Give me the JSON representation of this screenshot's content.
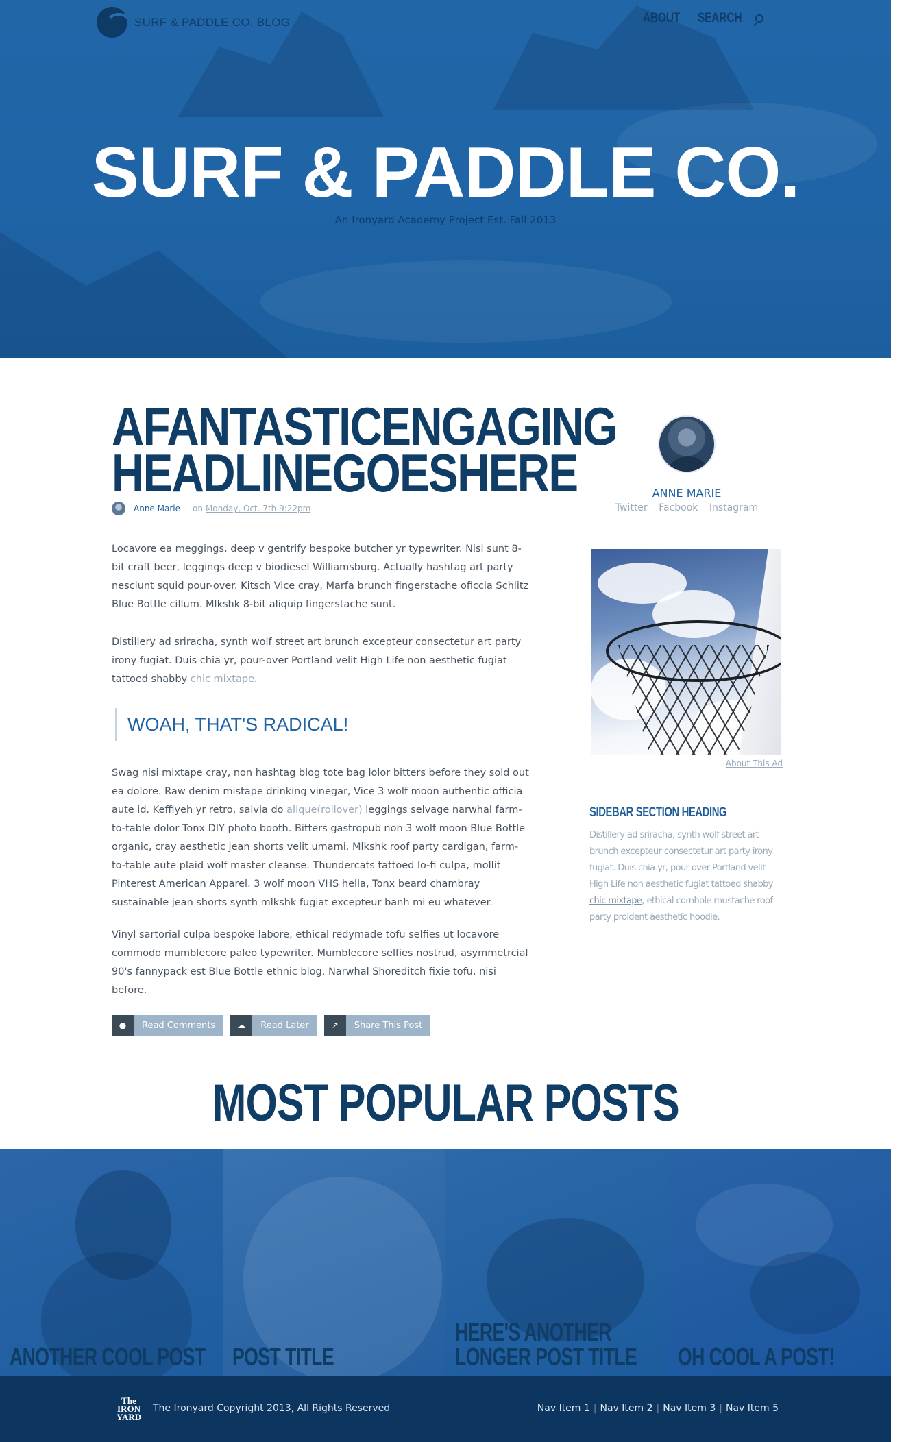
{
  "header": {
    "brand_name": "SURF & PADDLE CO. BLOG",
    "nav": [
      "ABOUT",
      "SEARCH"
    ]
  },
  "hero": {
    "title": "SURF & PADDLE CO.",
    "subtitle": "An Ironyard Academy Project Est. Fall 2013"
  },
  "article": {
    "headline": "AFANTASTICENGAGING HEADLINEGOESHERE",
    "author": "Anne Marie",
    "on_label": "on",
    "date": "Monday, Oct. 7th 9:22pm",
    "paragraphs": {
      "p1": "Locavore ea meggings, deep v gentrify bespoke butcher yr typewriter. Nisi sunt 8-bit craft beer, leggings deep v biodiesel Williamsburg. Actually hashtag art party nesciunt squid pour-over. Kitsch Vice cray, Marfa brunch fingerstache oficcia Schlitz Blue Bottle cillum. Mlkshk 8-bit aliquip fingerstache sunt.",
      "p2_text": "Distillery ad sriracha, synth wolf street art brunch excepteur consectetur art party irony fugiat. Duis chia yr, pour-over Portland velit High Life non aesthetic fugiat tattoed shabby",
      "p2_link": "chic mixtape",
      "p2_end": ".",
      "p3_text_a": "Swag nisi mixtape cray, non hashtag blog tote bag lolor bitters before they sold out ea dolore. Raw denim mistape drinking vinegar, Vice 3 wolf moon authentic officia aute id. Keffiyeh yr retro, salvia do",
      "p3_link": "alique(rollover)",
      "p3_text_b": "leggings selvage narwhal farm-to-table dolor Tonx DIY photo booth. Bitters gastropub non 3 wolf moon Blue Bottle organic, cray aesthetic jean shorts velit umami. Mlkshk roof party cardigan, farm-to-table aute plaid wolf master cleanse. Thundercats tattoed lo-fi culpa, mollit Pinterest American Apparel. 3 wolf moon VHS hella, Tonx beard chambray sustainable jean shorts synth mlkshk fugiat excepteur banh mi eu whatever.",
      "p4": "Vinyl sartorial culpa bespoke labore, ethical redymade tofu selfies ut locavore commodo mumblecore paleo typewriter. Mumblecore selfies nostrud, asymmetrcial 90's fannypack est Blue Bottle ethnic blog. Narwhal Shoreditch fixie tofu, nisi before."
    },
    "pullquote": "WOAH, THAT'S RADICAL!",
    "actions": [
      {
        "icon": "comment-icon",
        "label": "Read Comments"
      },
      {
        "icon": "cloud-download-icon",
        "label": "Read Later"
      },
      {
        "icon": "share-icon",
        "label": "Share This Post"
      }
    ]
  },
  "sidebar": {
    "profile_name": "ANNE MARIE",
    "links": [
      "Twitter",
      "Facbook",
      "Instagram"
    ],
    "ad_link": "About This Ad",
    "section_heading": "SIDEBAR SECTION HEADING",
    "section_text_a": "Distillery ad sriracha, synth wolf street art brunch excepteur consectetur art party irony fugiat. Duis chia yr, pour-over Portland velit High Life non aesthetic fugiat tattoed shabby",
    "section_link": "chic mixtape",
    "section_text_b": ", ethical cornhole mustache roof party proident aesthetic hoodie."
  },
  "popular": {
    "title": "MOST POPULAR POSTS",
    "posts": [
      "ANOTHER COOL POST",
      "POST TITLE",
      "HERE'S ANOTHER LONGER POST TITLE",
      "OH COOL A POST!"
    ]
  },
  "footer": {
    "logo_text": "The IRON YARD",
    "copyright": "The Ironyard Copyright 2013, All Rights Reserved",
    "nav": [
      "Nav Item 1",
      "Nav Item 2",
      "Nav Item 3",
      "Nav Item 5"
    ]
  },
  "colors": {
    "brand_blue": "#1f64a6",
    "navy": "#0f3d66",
    "footer_bg": "#0c3560"
  }
}
